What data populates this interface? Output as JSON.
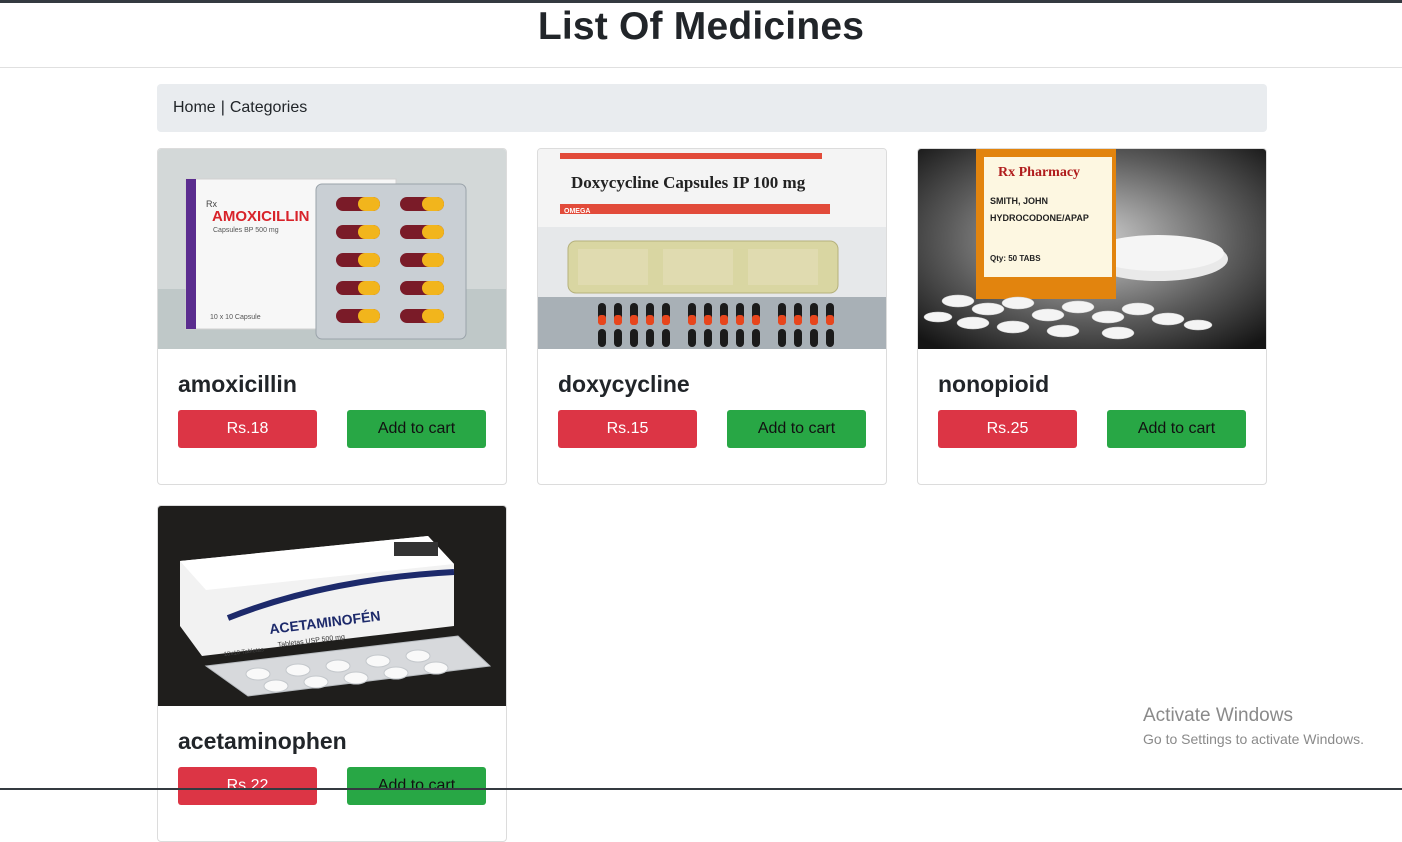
{
  "page": {
    "title": "List Of Medicines"
  },
  "breadcrumb": {
    "home": "Home",
    "separator": "|",
    "categories": "Categories"
  },
  "products": [
    {
      "name": "amoxicillin",
      "price": "Rs.18",
      "cart_label": "Add to cart",
      "image_label": "AMOXICILLIN",
      "image_sublabel": "Capsules BP 500 mg",
      "image_pack": "10 x 10 Capsule"
    },
    {
      "name": "doxycycline",
      "price": "Rs.15",
      "cart_label": "Add to cart",
      "image_label": "Doxycycline Capsules IP 100 mg",
      "image_brand": "OMEGA"
    },
    {
      "name": "nonopioid",
      "price": "Rs.25",
      "cart_label": "Add to cart",
      "image_label": "Rx Pharmacy",
      "image_sublabel": "HYDROCODONE/APAP",
      "image_name": "SMITH, JOHN",
      "image_qty": "Qty: 50 TABS"
    },
    {
      "name": "acetaminophen",
      "price": "Rs.22",
      "cart_label": "Add to cart",
      "image_label": "ACETAMINOFÉN",
      "image_sublabel": "Tabletas USP 500 mg",
      "image_pack": "10x10 Tabletas"
    }
  ],
  "colors": {
    "price_button": "#dc3545",
    "cart_button": "#28a745",
    "breadcrumb_bg": "#e9ecef"
  },
  "watermark": {
    "line1": "Activate Windows",
    "line2": "Go to Settings to activate Windows."
  }
}
